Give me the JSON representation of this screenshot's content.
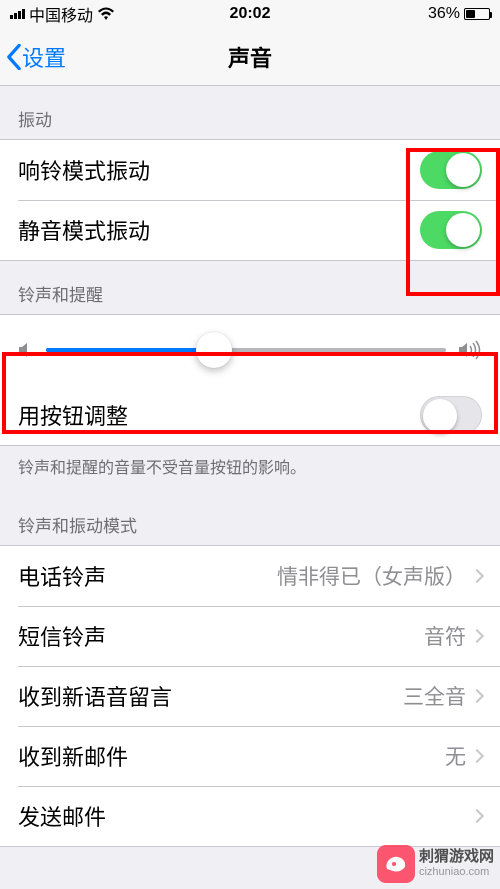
{
  "status": {
    "carrier": "中国移动",
    "time": "20:02",
    "battery_pct": "36%"
  },
  "nav": {
    "back_label": "设置",
    "title": "声音"
  },
  "vibration": {
    "header": "振动",
    "ring_vibrate_label": "响铃模式振动",
    "ring_vibrate_on": true,
    "silent_vibrate_label": "静音模式振动",
    "silent_vibrate_on": true
  },
  "ringer": {
    "header": "铃声和提醒",
    "slider_value": 0.42,
    "button_adjust_label": "用按钮调整",
    "button_adjust_on": false,
    "footer": "铃声和提醒的音量不受音量按钮的影响。"
  },
  "patterns": {
    "header": "铃声和振动模式",
    "items": [
      {
        "label": "电话铃声",
        "value": "情非得已（女声版）"
      },
      {
        "label": "短信铃声",
        "value": "音符"
      },
      {
        "label": "收到新语音留言",
        "value": "三全音"
      },
      {
        "label": "收到新邮件",
        "value": "无"
      },
      {
        "label": "发送邮件",
        "value": ""
      }
    ]
  },
  "watermark": {
    "name": "刺猬游戏网",
    "url": "cizhuniao.com"
  }
}
